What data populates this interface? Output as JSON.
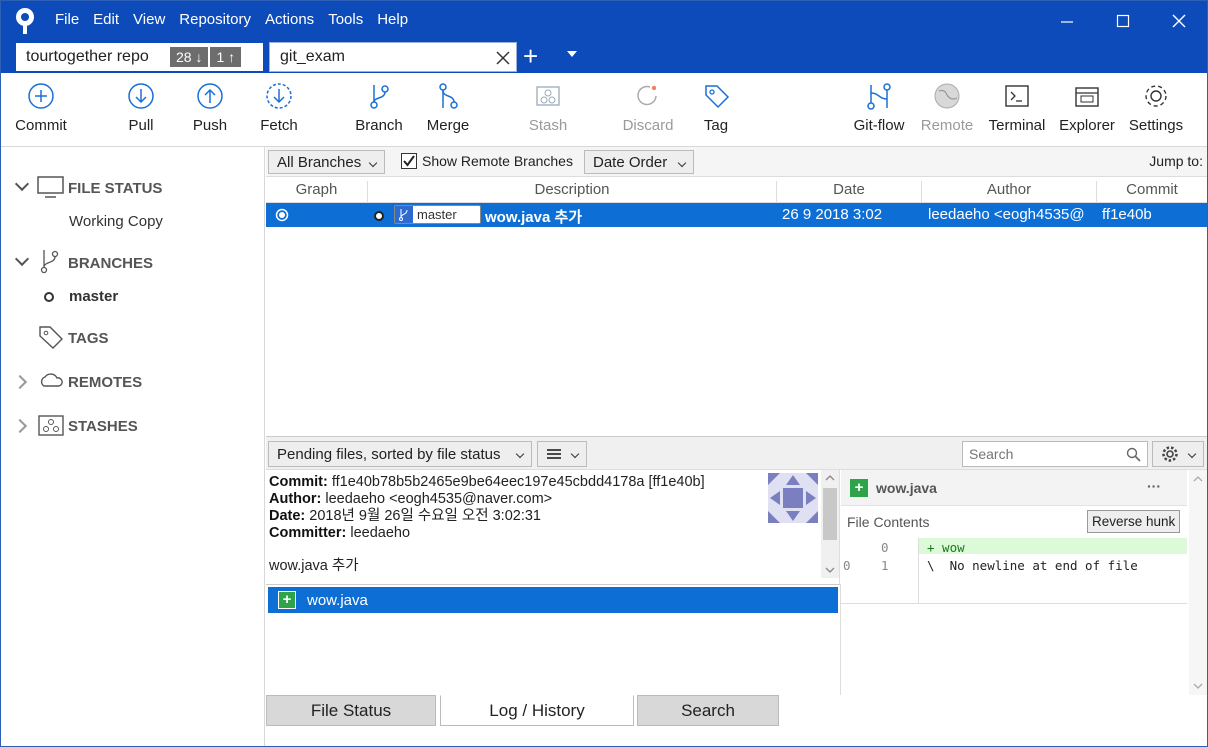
{
  "menu": [
    "File",
    "Edit",
    "View",
    "Repository",
    "Actions",
    "Tools",
    "Help"
  ],
  "tabs": {
    "tab1": {
      "label": "tourtogether repo",
      "behind": "28 ↓",
      "ahead": "1 ↑"
    },
    "tab2": {
      "label": "git_exam"
    }
  },
  "toolbar": {
    "commit": "Commit",
    "pull": "Pull",
    "push": "Push",
    "fetch": "Fetch",
    "branch": "Branch",
    "merge": "Merge",
    "stash": "Stash",
    "discard": "Discard",
    "tag": "Tag",
    "gitflow": "Git-flow",
    "remote": "Remote",
    "terminal": "Terminal",
    "explorer": "Explorer",
    "settings": "Settings"
  },
  "sidebar": {
    "file_status": "FILE STATUS",
    "working_copy": "Working Copy",
    "branches": "BRANCHES",
    "master": "master",
    "tags": "TAGS",
    "remotes": "REMOTES",
    "stashes": "STASHES"
  },
  "filter": {
    "branches": "All Branches",
    "show_remote": "Show Remote Branches",
    "order": "Date Order",
    "jump_to": "Jump to:"
  },
  "columns": {
    "graph": "Graph",
    "description": "Description",
    "date": "Date",
    "author": "Author",
    "commit": "Commit"
  },
  "commit": {
    "branch_label": "master",
    "message": "wow.java 추가",
    "date": "26 9 2018 3:02",
    "author": "leedaeho <eogh4535@",
    "hash": "ff1e40b"
  },
  "lower": {
    "pending": "Pending files, sorted by file status",
    "search_placeholder": "Search"
  },
  "details": {
    "commit_label": "Commit:",
    "commit_val": "ff1e40b78b5b2465e9be64eec197e45cbdd4178a [ff1e40b]",
    "author_label": "Author:",
    "author_val": "leedaeho <eogh4535@naver.com>",
    "date_label": "Date:",
    "date_val": "2018년 9월 26일 수요일 오전 3:02:31",
    "committer_label": "Committer:",
    "committer_val": "leedaeho",
    "message": "wow.java 추가"
  },
  "files": [
    "wow.java"
  ],
  "diff": {
    "file": "wow.java",
    "more": "···",
    "file_contents": "File Contents",
    "reverse": "Reverse hunk",
    "lines": [
      {
        "old": "",
        "new": "0",
        "text": "+ wow"
      },
      {
        "old": "0",
        "new": "1",
        "text": "\\  No newline at end of file"
      }
    ]
  },
  "bottom_tabs": {
    "file_status": "File Status",
    "log": "Log / History",
    "search": "Search"
  },
  "colors": {
    "title_bg": "#0d4bbb",
    "selected": "#0d6fd6",
    "added": "#2fa34a"
  }
}
